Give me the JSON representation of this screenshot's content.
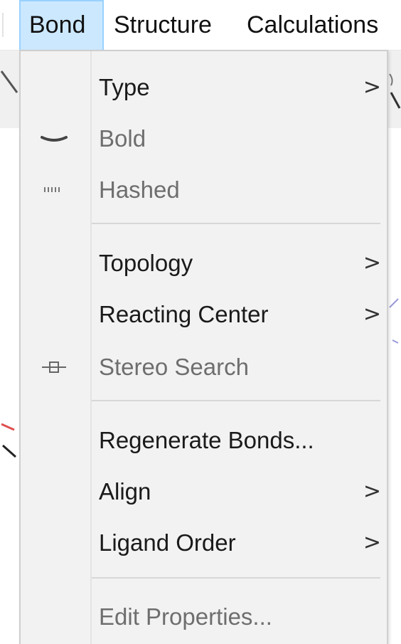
{
  "menubar": {
    "items": [
      {
        "label": "Bond",
        "active": true
      },
      {
        "label": "Structure",
        "active": false
      },
      {
        "label": "Calculations",
        "active": false
      }
    ]
  },
  "bond_menu": {
    "items": [
      {
        "label": "Type",
        "enabled": true,
        "has_submenu": true,
        "submenu_arrow": ">"
      },
      {
        "label": "Bold",
        "enabled": false,
        "icon": "bold-bond-icon"
      },
      {
        "label": "Hashed",
        "enabled": false,
        "icon": "hashed-bond-icon"
      },
      {
        "label": "Topology",
        "enabled": true,
        "has_submenu": true,
        "submenu_arrow": ">"
      },
      {
        "label": "Reacting Center",
        "enabled": true,
        "has_submenu": true,
        "submenu_arrow": ">"
      },
      {
        "label": "Stereo Search",
        "enabled": false,
        "icon": "stereo-search-icon"
      },
      {
        "label": "Regenerate Bonds...",
        "enabled": true
      },
      {
        "label": "Align",
        "enabled": true,
        "has_submenu": true,
        "submenu_arrow": ">"
      },
      {
        "label": "Ligand Order",
        "enabled": true,
        "has_submenu": true,
        "submenu_arrow": ">"
      },
      {
        "label": "Edit Properties...",
        "enabled": false
      }
    ]
  },
  "colors": {
    "menu_background": "#f2f2f2",
    "active_menubar_bg": "#cce8ff",
    "active_menubar_border": "#99d1ff",
    "disabled_text": "#6e6e6e",
    "enabled_text": "#1a1a1a"
  }
}
